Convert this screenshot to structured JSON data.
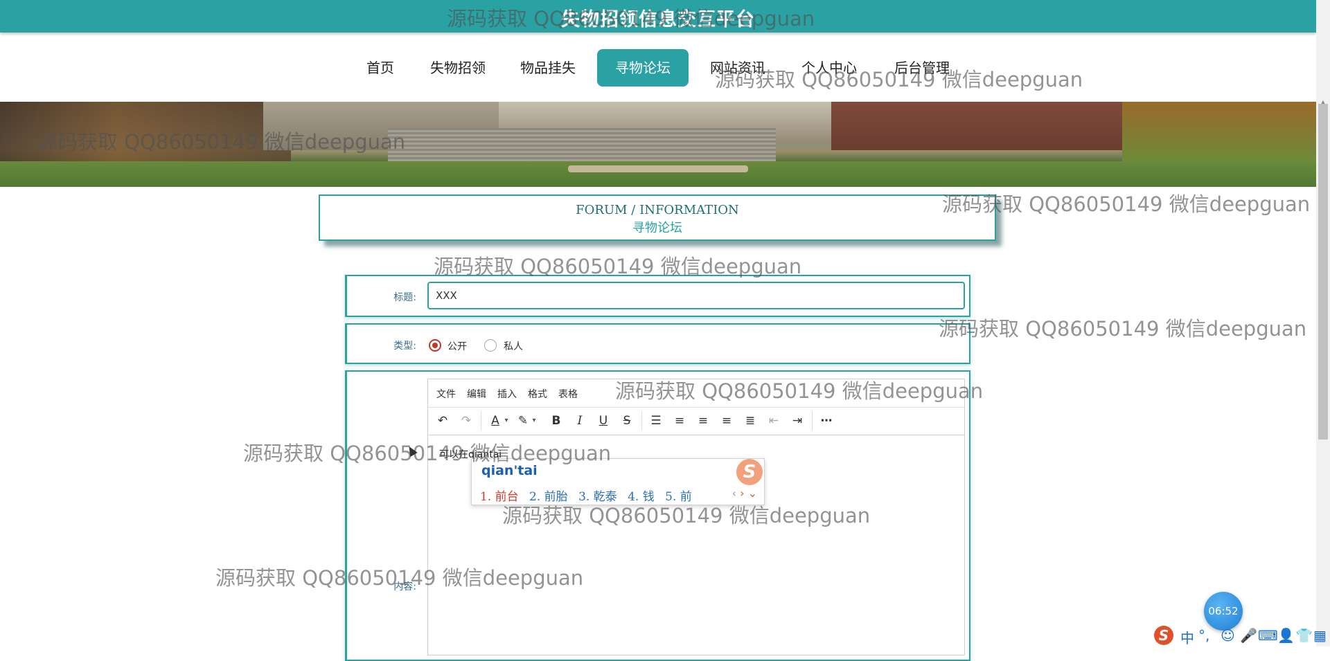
{
  "site_title": "失物招领信息交互平台",
  "nav": {
    "items": [
      "首页",
      "失物招领",
      "物品挂失",
      "寻物论坛",
      "网站资讯",
      "个人中心",
      "后台管理"
    ],
    "active": "寻物论坛"
  },
  "forum_header": {
    "en": "FORUM / INFORMATION",
    "cn": "寻物论坛"
  },
  "form": {
    "title_label": "标题:",
    "title_value": "XXX",
    "type_label": "类型:",
    "type_options": [
      "公开",
      "私人"
    ],
    "type_selected": "公开",
    "content_label": "内容:"
  },
  "editor": {
    "menus": [
      "文件",
      "编辑",
      "插入",
      "格式",
      "表格"
    ],
    "toolbar_icons": [
      "undo-icon",
      "redo-icon",
      "font-color-icon",
      "highlight-icon",
      "bold-icon",
      "italic-icon",
      "underline-icon",
      "strikethrough-icon",
      "list-icon",
      "align-left-icon",
      "align-center-icon",
      "align-right-icon",
      "align-justify-icon",
      "outdent-icon",
      "indent-icon",
      "more-icon"
    ],
    "content_text": "可以在qiantai"
  },
  "ime": {
    "pinyin": "qian'tai",
    "candidates": [
      "1. 前台",
      "2. 前胎",
      "3. 乾泰",
      "4. 钱",
      "5. 前"
    ],
    "logo": "S"
  },
  "watermark": "源码获取 QQ86050149 微信deepguan",
  "clock": "06:52",
  "ime_status": {
    "lang": "中",
    "punct": "°,"
  },
  "colors": {
    "accent": "#2aa2a4",
    "radio_checked": "#c0392b",
    "ime_candidate": "#2b6fb6",
    "ime_first_candidate": "#d23b2b"
  }
}
